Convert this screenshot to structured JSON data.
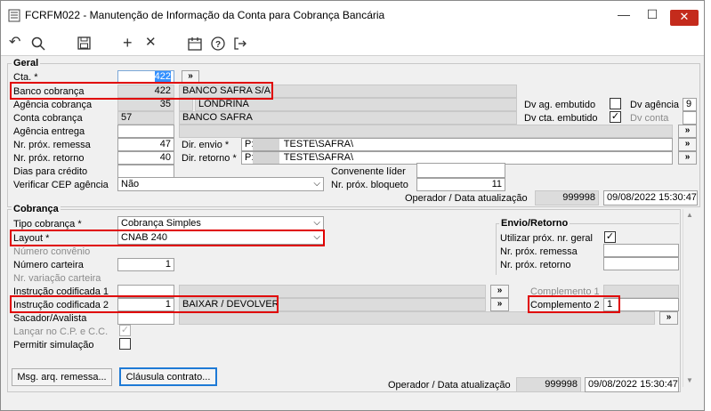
{
  "window": {
    "title": "FCRFM022 - Manutenção de Informação da Conta para Cobrança Bancária",
    "minimize": "—",
    "maximize": "☐",
    "close": "✕"
  },
  "toolbar": {
    "undo": "↶",
    "search": "🔍",
    "save": "💾",
    "add": "+",
    "delete": "✕",
    "calendar": "📅",
    "help": "?",
    "exit": "↦"
  },
  "geral": {
    "heading": "Geral",
    "cta_label": "Cta. *",
    "cta_value": "422",
    "cta_btn": "»",
    "banco_label": "Banco cobrança",
    "banco_code": "422",
    "banco_name": "BANCO SAFRA S/A.",
    "agencia_label": "Agência cobrança",
    "agencia_code": "35",
    "agencia_name": "LONDRINA",
    "dv_ag_emb_label": "Dv ag. embutido",
    "dv_agencia_label": "Dv agência",
    "dv_agencia_value": "9",
    "conta_label": "Conta cobrança",
    "conta_code": "57",
    "conta_name": "BANCO SAFRA",
    "dv_cta_emb_label": "Dv cta. embutido",
    "dv_cta_emb_check": "✓",
    "dv_conta_label": "Dv conta",
    "agencia_entrega_label": "Agência entrega",
    "agencia_entrega_btn": "»",
    "nr_prox_remessa_label": "Nr. próx. remessa",
    "nr_prox_remessa_value": "47",
    "dir_envio_label": "Dir. envio *",
    "dir_envio_value": "P:\\          TESTE\\SAFRA\\",
    "dir_envio_btn": "»",
    "nr_prox_retorno_label": "Nr. próx. retorno",
    "nr_prox_retorno_value": "40",
    "dir_retorno_label": "Dir. retorno *",
    "dir_retorno_value": "P:\\          TESTE\\SAFRA\\",
    "dir_retorno_btn": "»",
    "dias_credito_label": "Dias para crédito",
    "convenente_label": "Convenente líder",
    "verificar_cep_label": "Verificar CEP agência",
    "verificar_cep_value": "Não",
    "nr_prox_bloqueto_label": "Nr. próx. bloqueto",
    "nr_prox_bloqueto_value": "11",
    "operador_label": "Operador / Data atualização",
    "operador_value": "999998",
    "data_value": "09/08/2022 15:30:47"
  },
  "cobranca": {
    "heading": "Cobrança",
    "tipo_label": "Tipo cobrança *",
    "tipo_value": "Cobrança Simples",
    "layout_label": "Layout *",
    "layout_value": "CNAB 240",
    "num_convenio_label": "Número convênio",
    "num_carteira_label": "Número carteira",
    "num_carteira_value": "1",
    "nr_variacao_label": "Nr. variação carteira",
    "instr1_label": "Instrução codificada 1",
    "instr1_btn": "»",
    "complemento1_label": "Complemento 1",
    "instr2_label": "Instrução codificada 2",
    "instr2_code": "1",
    "instr2_name": "BAIXAR / DEVOLVER",
    "instr2_btn": "»",
    "complemento2_label": "Complemento 2",
    "complemento2_value": "1",
    "sacador_label": "Sacador/Avalista",
    "sacador_btn": "»",
    "lancar_label": "Lançar no C.P. e C.C.",
    "lancar_check": "✓",
    "permitir_label": "Permitir simulação",
    "envio_heading": "Envio/Retorno",
    "utilizar_label": "Utilizar próx. nr. geral",
    "utilizar_check": "✓",
    "env_remessa_label": "Nr. próx. remessa",
    "env_retorno_label": "Nr. próx. retorno",
    "msg_btn": "Msg. arq. remessa...",
    "clausula_btn": "Cláusula contrato...",
    "operador_label": "Operador / Data atualização",
    "operador_value": "999998",
    "data_value": "09/08/2022 15:30:47"
  },
  "scrollbar": {
    "up": "▲",
    "down": "▼"
  },
  "colors": {
    "highlight": "#e00000",
    "selection": "#3390ff",
    "close": "#c42b1c"
  }
}
